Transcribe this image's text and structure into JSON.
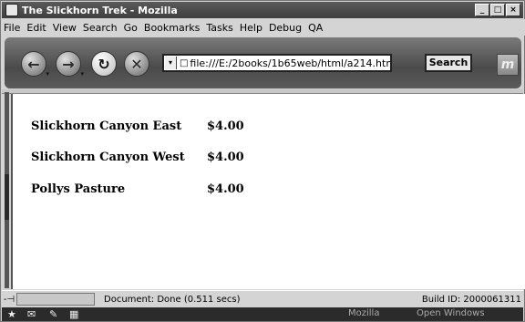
{
  "window": {
    "title": "The Slickhorn Trek - Mozilla",
    "controls": [
      "_",
      "□",
      "×"
    ]
  },
  "menu": [
    {
      "label": "File"
    },
    {
      "label": "Edit"
    },
    {
      "label": "View"
    },
    {
      "label": "Search"
    },
    {
      "label": "Go"
    },
    {
      "label": "Bookmarks"
    },
    {
      "label": "Tasks"
    },
    {
      "label": "Help"
    },
    {
      "label": "Debug"
    },
    {
      "label": "QA"
    }
  ],
  "toolbar": {
    "back_icon": "back-arrow-icon",
    "forward_icon": "forward-arrow-icon",
    "reload_icon": "reload-icon",
    "stop_icon": "stop-icon",
    "url_value": "file:///E:/2books/1b65web/html/a214.htm",
    "search_label": "Search",
    "throbber_letter": "m"
  },
  "content": {
    "rows": [
      {
        "name": "Slickhorn Canyon East",
        "price": "$4.00"
      },
      {
        "name": "Slickhorn Canyon West",
        "price": "$4.00"
      },
      {
        "name": "Pollys Pasture",
        "price": "$4.00"
      }
    ]
  },
  "status": {
    "text": "Document: Done (0.511 secs)",
    "build": "Build ID: 2000061311"
  },
  "taskbar": {
    "items": [
      "Mozilla",
      "Open Windows"
    ]
  }
}
